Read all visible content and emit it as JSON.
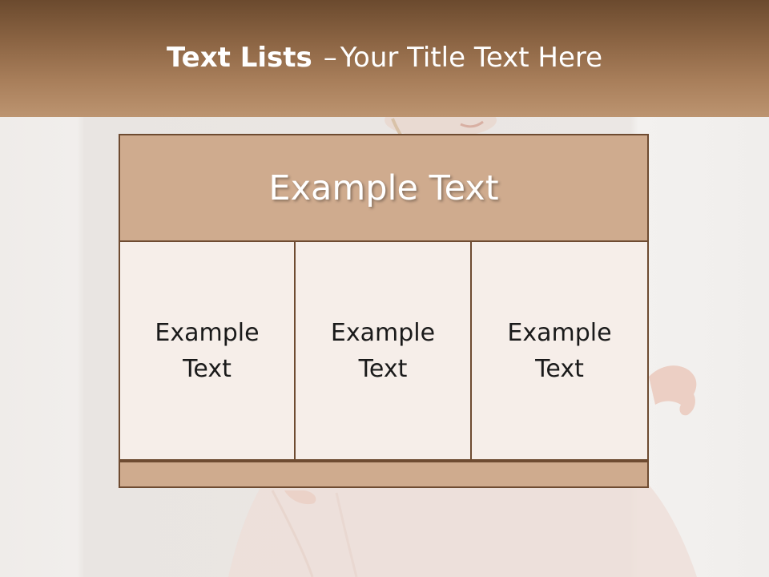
{
  "header": {
    "title_bold": "Text Lists",
    "title_dash": "–",
    "title_rest": "Your Title Text Here"
  },
  "diagram": {
    "top_label": "Example Text",
    "columns": [
      {
        "label": "Example\nText"
      },
      {
        "label": "Example\nText"
      },
      {
        "label": "Example\nText"
      }
    ]
  },
  "colors": {
    "header_top": "#6b4a2e",
    "header_bottom": "#bc9470",
    "box_fill": "#cfab8e",
    "cell_fill": "#f6eee9",
    "border": "#6e4b31"
  }
}
